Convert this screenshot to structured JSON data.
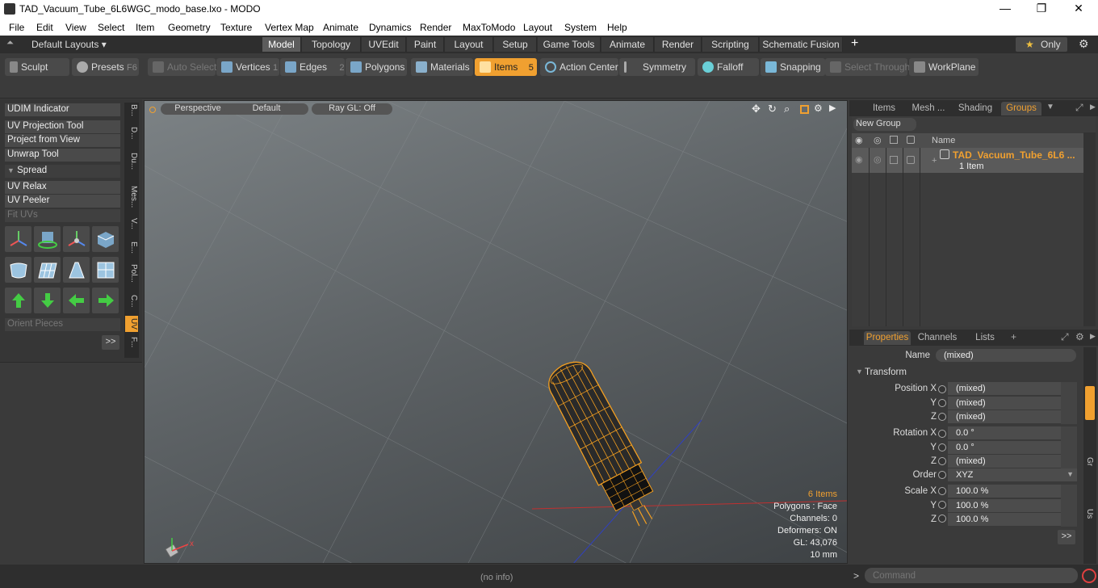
{
  "window": {
    "title": "TAD_Vacuum_Tube_6L6WGC_modo_base.lxo - MODO",
    "minimize": "—",
    "maximize": "❐",
    "close": "✕"
  },
  "menu": [
    "File",
    "Edit",
    "View",
    "Select",
    "Item",
    "Geometry",
    "Texture",
    "Vertex Map",
    "Animate",
    "Dynamics",
    "Render",
    "MaxToModo",
    "Layout",
    "System",
    "Help"
  ],
  "layouts": {
    "label": "Default Layouts ▾",
    "tabs": [
      "Model",
      "Topology",
      "UVEdit",
      "Paint",
      "Layout",
      "Setup",
      "Game Tools",
      "Animate",
      "Render",
      "Scripting",
      "Schematic Fusion"
    ],
    "active": "Model",
    "add": "+",
    "only": "Only",
    "star": "★"
  },
  "toolbar": {
    "sculpt": "Sculpt",
    "presets": "Presets",
    "presets_key": "F6",
    "auto_select": "Auto Select",
    "vertices": "Vertices",
    "vertices_key": "1",
    "edges": "Edges",
    "edges_key": "2",
    "polygons": "Polygons",
    "materials": "Materials",
    "items": "Items",
    "items_key": "5",
    "action_center": "Action Center",
    "symmetry": "Symmetry",
    "falloff": "Falloff",
    "snapping": "Snapping",
    "select_through": "Select Through",
    "workplane": "WorkPlane"
  },
  "leftpanel": {
    "udim": "UDIM Indicator",
    "uv_projection": "UV Projection Tool",
    "project_view": "Project from View",
    "unwrap": "Unwrap Tool",
    "spread": "Spread",
    "uv_relax": "UV Relax",
    "uv_peeler": "UV Peeler",
    "fit_uvs": "Fit UVs",
    "orient": "Orient Pieces",
    "more": ">>",
    "vtabs": [
      "B...",
      "D...",
      "Du...",
      "Mes...",
      "V...",
      "E...",
      "Pol...",
      "C...",
      "UV",
      "F..."
    ]
  },
  "viewport": {
    "perspective": "Perspective",
    "default": "Default",
    "raygl": "Ray GL: Off",
    "info": {
      "items": "6 Items",
      "polygons": "Polygons : Face",
      "channels": "Channels: 0",
      "deformers": "Deformers: ON",
      "gl": "GL: 43,076",
      "scale": "10 mm"
    }
  },
  "status": "(no info)",
  "rightpanel": {
    "tabs": [
      "Items",
      "Mesh ...",
      "Shading",
      "Groups"
    ],
    "active": "Groups",
    "new_group": "New Group",
    "col_name": "Name",
    "group_name": "TAD_Vacuum_Tube_6L6 ...",
    "group_count": "1 Item"
  },
  "props": {
    "tabs": [
      "Properties",
      "Channels",
      "Lists"
    ],
    "add": "+",
    "name_label": "Name",
    "name_value": "(mixed)",
    "transform": "Transform",
    "position_label": "Position X",
    "rotation_label": "Rotation X",
    "scale_label": "Scale X",
    "y": "Y",
    "z": "Z",
    "pos": [
      "(mixed)",
      "(mixed)",
      "(mixed)"
    ],
    "rot": [
      "0.0 °",
      "0.0 °",
      "(mixed)"
    ],
    "scale": [
      "100.0 %",
      "100.0 %",
      "100.0 %"
    ],
    "order_label": "Order",
    "order_value": "XYZ",
    "more": ">>",
    "side_g": "Gr",
    "side_u": "Us"
  },
  "command": {
    "placeholder": "Command",
    "prompt": ">"
  },
  "colors": {
    "accent": "#f0a030",
    "wire": "#f5a020"
  }
}
